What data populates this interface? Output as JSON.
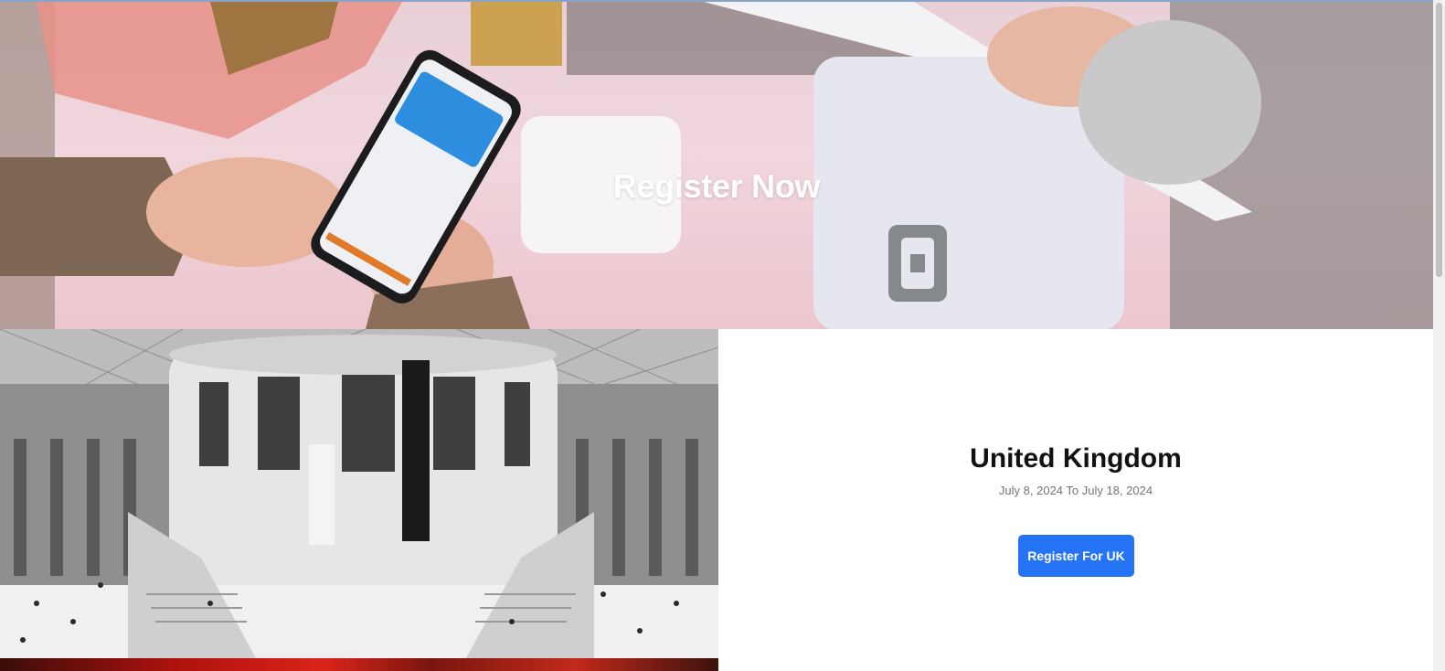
{
  "hero": {
    "title": "Register Now"
  },
  "events": [
    {
      "country": "United Kingdom",
      "dates": "July 8, 2024 To July 18, 2024",
      "button_label": "Register For UK"
    }
  ],
  "colors": {
    "button": "#2474f5",
    "hero_text": "#ffffff",
    "date_text": "#707780"
  }
}
